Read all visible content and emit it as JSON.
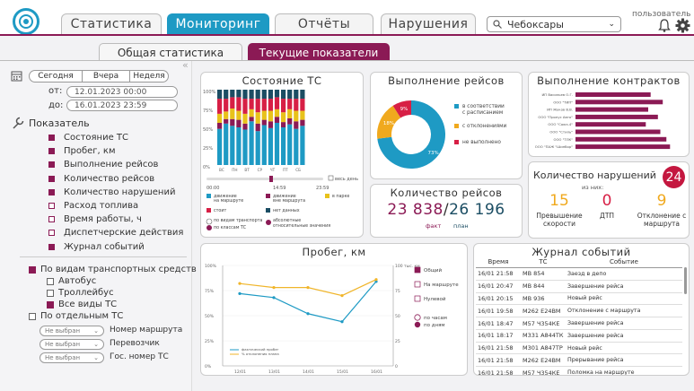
{
  "nav": {
    "tabs": [
      "Статистика",
      "Мониторинг",
      "Отчёты",
      "Нарушения"
    ],
    "active": 1,
    "city": "Чебоксары",
    "user": "пользователь"
  },
  "subtabs": [
    "Общая статистика",
    "Текущие показатели"
  ],
  "period": {
    "buttons": [
      "Сегодня",
      "Вчера",
      "Неделя"
    ],
    "from_label": "от:",
    "from": "12.01.2023 00:00",
    "to_label": "до:",
    "to": "16.01.2023 23:59"
  },
  "indicators": {
    "title": "Показатель",
    "items": [
      {
        "label": "Состояние ТС",
        "on": true
      },
      {
        "label": "Пробег, км",
        "on": true
      },
      {
        "label": "Выполнение рейсов",
        "on": true
      },
      {
        "label": "Количество рейсов",
        "on": true
      },
      {
        "label": "Количество нарушений",
        "on": true
      },
      {
        "label": "Расход топлива",
        "on": false
      },
      {
        "label": "Время работы, ч",
        "on": false
      },
      {
        "label": "Диспетчерские действия",
        "on": false
      },
      {
        "label": "Журнал событий",
        "on": true
      }
    ]
  },
  "transport": {
    "by_type": "По видам транспортных средств",
    "types": [
      {
        "label": "Автобус",
        "on": false
      },
      {
        "label": "Троллейбус",
        "on": false
      },
      {
        "label": "Все виды ТС",
        "on": true
      }
    ],
    "by_each": "По отдельным ТС",
    "filters": [
      {
        "value": "Не выбран",
        "label": "Номер маршрута"
      },
      {
        "value": "Не выбран",
        "label": "Перевозчик"
      },
      {
        "value": "Не выбран",
        "label": "Гос. номер ТС"
      }
    ]
  },
  "state": {
    "title": "Состояние ТС",
    "yticks": [
      "100%",
      "75%",
      "50%",
      "25%",
      "0%"
    ],
    "xticks": [
      "ВС",
      "ПН",
      "ВТ",
      "СР",
      "ЧТ",
      "ПТ",
      "СБ"
    ],
    "all_day": "весь день",
    "time_start": "00:00",
    "time_mid": "14:59",
    "time_end": "23:59",
    "legend": [
      "движение на маршруте",
      "движение вне маршрута",
      "в парке",
      "стоит",
      "нет данных"
    ],
    "options": [
      "по видам транспорта",
      "по классам ТС",
      "абсолютные",
      "относительные значения"
    ],
    "colors": [
      "#1e9ac4",
      "#8b1a55",
      "#e8c21b",
      "#d71f45",
      "#1b4d63"
    ],
    "stacks": [
      [
        48,
        8,
        12,
        20,
        12
      ],
      [
        55,
        6,
        10,
        17,
        12
      ],
      [
        52,
        9,
        14,
        15,
        10
      ],
      [
        50,
        10,
        12,
        18,
        10
      ],
      [
        47,
        8,
        13,
        20,
        12
      ],
      [
        58,
        6,
        10,
        14,
        12
      ],
      [
        45,
        10,
        15,
        18,
        12
      ],
      [
        53,
        7,
        12,
        16,
        12
      ],
      [
        49,
        9,
        14,
        16,
        12
      ],
      [
        56,
        8,
        10,
        16,
        10
      ],
      [
        50,
        7,
        13,
        18,
        12
      ],
      [
        54,
        8,
        12,
        14,
        12
      ],
      [
        48,
        10,
        14,
        16,
        12
      ],
      [
        52,
        8,
        12,
        16,
        12
      ]
    ]
  },
  "trips": {
    "title": "Выполнение рейсов",
    "legend": [
      "в соответствии с расписанием",
      "с отклонениями",
      "не выполнено"
    ],
    "values": [
      73,
      18,
      9
    ],
    "labels": [
      "73%",
      "18%",
      "9%"
    ],
    "colors": [
      "#1e9ac4",
      "#f0a91e",
      "#d71f45"
    ]
  },
  "contracts": {
    "title": "Выполнение контрактов",
    "carriers": [
      "ИП Васильев О.Г.",
      "ООО \"ТИП\"",
      "ИП Жуков В.В.",
      "ООО \"Пронус Авто\"",
      "ООО \"Союз-4\"",
      "ООО \"Стиль\"",
      "ООО \"ТЛК\"",
      "ООО \"ПАЖ \"Шинбор\""
    ],
    "values": [
      62,
      72,
      60,
      68,
      58,
      70,
      75,
      78
    ]
  },
  "count": {
    "title": "Количество рейсов",
    "fact": "23 838",
    "plan": "26 196",
    "sep": "/",
    "fact_label": "факт",
    "plan_label": "план"
  },
  "violations": {
    "title": "Количество нарушений",
    "total": "24",
    "sub": "из них:",
    "items": [
      {
        "value": "15",
        "label": "Превышение скорости",
        "color": "#f0a91e"
      },
      {
        "value": "0",
        "label": "ДТП",
        "color": "#d71f45"
      },
      {
        "value": "9",
        "label": "Отклонение с маршрута",
        "color": "#f0a91e"
      }
    ]
  },
  "mileage": {
    "title": "Пробег, км",
    "yleft": [
      "100%",
      "75%",
      "50%",
      "25%",
      "0%"
    ],
    "yright": [
      "100 тыс. км",
      "75",
      "50",
      "25",
      "0"
    ],
    "x": [
      "12/01",
      "13/01",
      "14/01",
      "15/01",
      "16/01"
    ],
    "series": [
      {
        "values": [
          72,
          68,
          52,
          44,
          84
        ],
        "color": "#1e9ac4",
        "legend": "фактический пробег"
      },
      {
        "values": [
          82,
          78,
          78,
          70,
          86
        ],
        "color": "#f0b52a",
        "legend": "% отклонения плана"
      }
    ],
    "legend_right": [
      {
        "label": "Общий",
        "on": true
      },
      {
        "label": "На маршруте",
        "on": false
      },
      {
        "label": "Нулевой",
        "on": false
      }
    ],
    "mode": [
      "по часам",
      "по дням"
    ]
  },
  "journal": {
    "title": "Журнал событий",
    "headers": [
      "Время",
      "ТС",
      "Событие"
    ],
    "rows": [
      [
        "16/01 21:58",
        "МВ 854",
        "Заезд в депо"
      ],
      [
        "16/01 20:47",
        "МВ 844",
        "Завершение рейса"
      ],
      [
        "16/01 20:15",
        "МВ 936",
        "Новый рейс"
      ],
      [
        "16/01 19:58",
        "М262 Е24ВМ",
        "Отклонение с маршрута"
      ],
      [
        "16/01 18:47",
        "М57 Ч354КЕ",
        "Завершение рейса"
      ],
      [
        "16/01 18:17",
        "М331 А844ТК",
        "Завершение рейса"
      ],
      [
        "16/01 21:58",
        "М301 А847ТР",
        "Новый рейс"
      ],
      [
        "16/01 21:58",
        "М262 Е24ВМ",
        "Прерывание рейса"
      ],
      [
        "16/01 21:58",
        "М57 Ч354КЕ",
        "Поломка на маршруте"
      ]
    ]
  }
}
